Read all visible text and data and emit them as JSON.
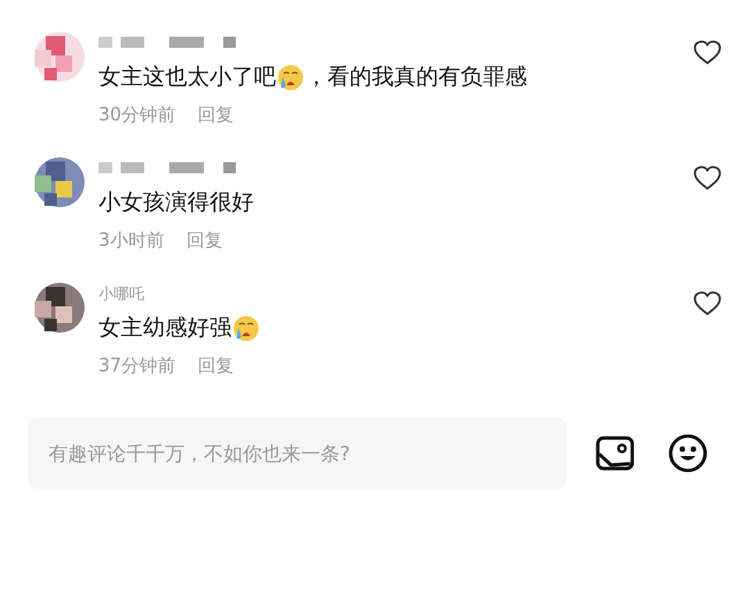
{
  "comments": [
    {
      "color": "#e05a75",
      "segments": [
        {
          "kind": "text",
          "text": "女主这也太小了吧"
        },
        {
          "kind": "emoji"
        },
        {
          "kind": "text",
          "text": "，看的我真的有负罪感"
        }
      ],
      "time": "30分钟前",
      "reply": "回复",
      "liked": false
    },
    {
      "color": "#4f5f8f",
      "segments": [
        {
          "kind": "text",
          "text": "小女孩演得很好"
        }
      ],
      "time": "3小时前",
      "reply": "回复",
      "liked": false
    },
    {
      "color": "#3a3334",
      "name": "小哪吒",
      "segments": [
        {
          "kind": "text",
          "text": "女主幼感好强"
        },
        {
          "kind": "emoji"
        }
      ],
      "time": "37分钟前",
      "reply": "回复",
      "liked": false
    }
  ],
  "composer": {
    "placeholder": "有趣评论千千万，不如你也来一条?"
  }
}
